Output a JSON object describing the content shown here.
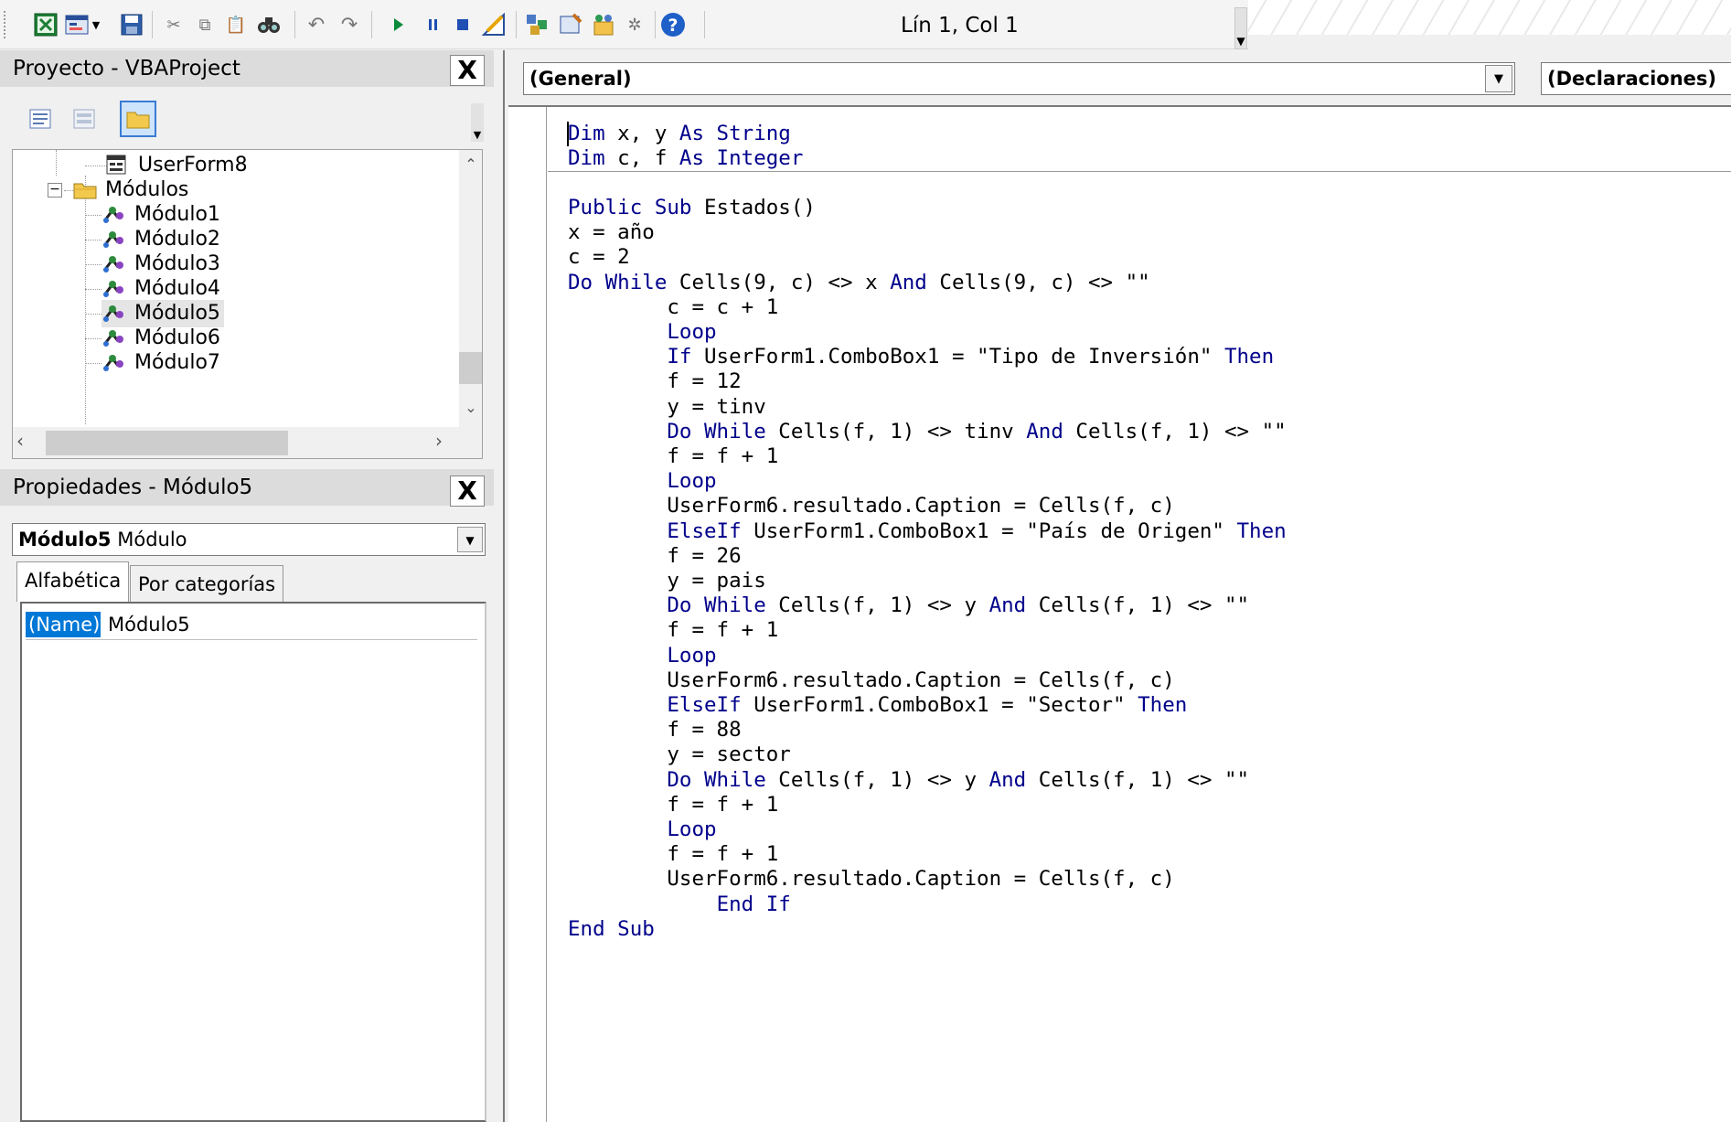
{
  "toolbar": {
    "cursor_position": "Lín 1, Col 1",
    "icons": [
      "excel-view-icon",
      "insert-object-icon",
      "save-icon",
      "cut-icon",
      "copy-icon",
      "paste-icon",
      "find-icon",
      "undo-icon",
      "redo-icon",
      "run-icon",
      "break-icon",
      "reset-icon",
      "design-mode-icon",
      "project-explorer-icon",
      "properties-window-icon",
      "object-browser-icon",
      "toolbox-icon",
      "help-icon"
    ]
  },
  "project": {
    "title": "Proyecto - VBAProject",
    "close": "X",
    "tree": [
      {
        "label": "UserForm8",
        "icon": "userform-icon"
      },
      {
        "label": "Módulos",
        "icon": "folder-icon",
        "expander": "⊟"
      },
      {
        "label": "Módulo1",
        "icon": "module-icon"
      },
      {
        "label": "Módulo2",
        "icon": "module-icon"
      },
      {
        "label": "Módulo3",
        "icon": "module-icon"
      },
      {
        "label": "Módulo4",
        "icon": "module-icon"
      },
      {
        "label": "Módulo5",
        "icon": "module-icon"
      },
      {
        "label": "Módulo6",
        "icon": "module-icon"
      },
      {
        "label": "Módulo7",
        "icon": "module-icon"
      }
    ]
  },
  "properties": {
    "title": "Propiedades - Módulo5",
    "close": "X",
    "object_name": "Módulo5",
    "object_type": "Módulo",
    "tabs": [
      "Alfabética",
      "Por categorías"
    ],
    "rows": [
      {
        "name": "(Name)",
        "value": "Módulo5"
      }
    ]
  },
  "code": {
    "object_combo": "(General)",
    "procedure_combo": "(Declaraciones)",
    "declarations": [
      {
        "indent": 0,
        "parts": [
          [
            "kw",
            "Dim"
          ],
          [
            "t",
            " x, y "
          ],
          [
            "kw",
            "As String"
          ]
        ]
      },
      {
        "indent": 0,
        "parts": [
          [
            "kw",
            "Dim"
          ],
          [
            "t",
            " c, f "
          ],
          [
            "kw",
            "As Integer"
          ]
        ]
      }
    ],
    "lines": [
      {
        "indent": 0,
        "parts": [
          [
            "kw",
            "Public Sub"
          ],
          [
            "t",
            " Estados()"
          ]
        ]
      },
      {
        "indent": 0,
        "parts": [
          [
            "t",
            "x = año"
          ]
        ]
      },
      {
        "indent": 0,
        "parts": [
          [
            "t",
            "c = 2"
          ]
        ]
      },
      {
        "indent": 0,
        "parts": [
          [
            "kw",
            "Do While"
          ],
          [
            "t",
            " Cells(9, c) <> x "
          ],
          [
            "kw",
            "And"
          ],
          [
            "t",
            " Cells(9, c) <> \"\""
          ]
        ]
      },
      {
        "indent": 8,
        "parts": [
          [
            "t",
            "c = c + 1"
          ]
        ]
      },
      {
        "indent": 8,
        "parts": [
          [
            "kw",
            "Loop"
          ]
        ]
      },
      {
        "indent": 8,
        "parts": [
          [
            "kw",
            "If"
          ],
          [
            "t",
            " UserForm1.ComboBox1 = \"Tipo de Inversión\" "
          ],
          [
            "kw",
            "Then"
          ]
        ]
      },
      {
        "indent": 8,
        "parts": [
          [
            "t",
            "f = 12"
          ]
        ]
      },
      {
        "indent": 8,
        "parts": [
          [
            "t",
            "y = tinv"
          ]
        ]
      },
      {
        "indent": 8,
        "parts": [
          [
            "kw",
            "Do While"
          ],
          [
            "t",
            " Cells(f, 1) <> tinv "
          ],
          [
            "kw",
            "And"
          ],
          [
            "t",
            " Cells(f, 1) <> \"\""
          ]
        ]
      },
      {
        "indent": 8,
        "parts": [
          [
            "t",
            "f = f + 1"
          ]
        ]
      },
      {
        "indent": 8,
        "parts": [
          [
            "kw",
            "Loop"
          ]
        ]
      },
      {
        "indent": 8,
        "parts": [
          [
            "t",
            "UserForm6.resultado.Caption = Cells(f, c)"
          ]
        ]
      },
      {
        "indent": 8,
        "parts": [
          [
            "kw",
            "ElseIf"
          ],
          [
            "t",
            " UserForm1.ComboBox1 = \"País de Origen\" "
          ],
          [
            "kw",
            "Then"
          ]
        ]
      },
      {
        "indent": 8,
        "parts": [
          [
            "t",
            "f = 26"
          ]
        ]
      },
      {
        "indent": 8,
        "parts": [
          [
            "t",
            "y = pais"
          ]
        ]
      },
      {
        "indent": 8,
        "parts": [
          [
            "kw",
            "Do While"
          ],
          [
            "t",
            " Cells(f, 1) <> y "
          ],
          [
            "kw",
            "And"
          ],
          [
            "t",
            " Cells(f, 1) <> \"\""
          ]
        ]
      },
      {
        "indent": 8,
        "parts": [
          [
            "t",
            "f = f + 1"
          ]
        ]
      },
      {
        "indent": 8,
        "parts": [
          [
            "kw",
            "Loop"
          ]
        ]
      },
      {
        "indent": 8,
        "parts": [
          [
            "t",
            "UserForm6.resultado.Caption = Cells(f, c)"
          ]
        ]
      },
      {
        "indent": 8,
        "parts": [
          [
            "kw",
            "ElseIf"
          ],
          [
            "t",
            " UserForm1.ComboBox1 = \"Sector\" "
          ],
          [
            "kw",
            "Then"
          ]
        ]
      },
      {
        "indent": 8,
        "parts": [
          [
            "t",
            "f = 88"
          ]
        ]
      },
      {
        "indent": 8,
        "parts": [
          [
            "t",
            "y = sector"
          ]
        ]
      },
      {
        "indent": 8,
        "parts": [
          [
            "kw",
            "Do While"
          ],
          [
            "t",
            " Cells(f, 1) <> y "
          ],
          [
            "kw",
            "And"
          ],
          [
            "t",
            " Cells(f, 1) <> \"\""
          ]
        ]
      },
      {
        "indent": 8,
        "parts": [
          [
            "t",
            "f = f + 1"
          ]
        ]
      },
      {
        "indent": 8,
        "parts": [
          [
            "kw",
            "Loop"
          ]
        ]
      },
      {
        "indent": 8,
        "parts": [
          [
            "t",
            "f = f + 1"
          ]
        ]
      },
      {
        "indent": 8,
        "parts": [
          [
            "t",
            "UserForm6.resultado.Caption = Cells(f, c)"
          ]
        ]
      },
      {
        "indent": 12,
        "parts": [
          [
            "kw",
            "End If"
          ]
        ]
      },
      {
        "indent": 0,
        "parts": [
          [
            "kw",
            "End Sub"
          ]
        ]
      }
    ]
  }
}
